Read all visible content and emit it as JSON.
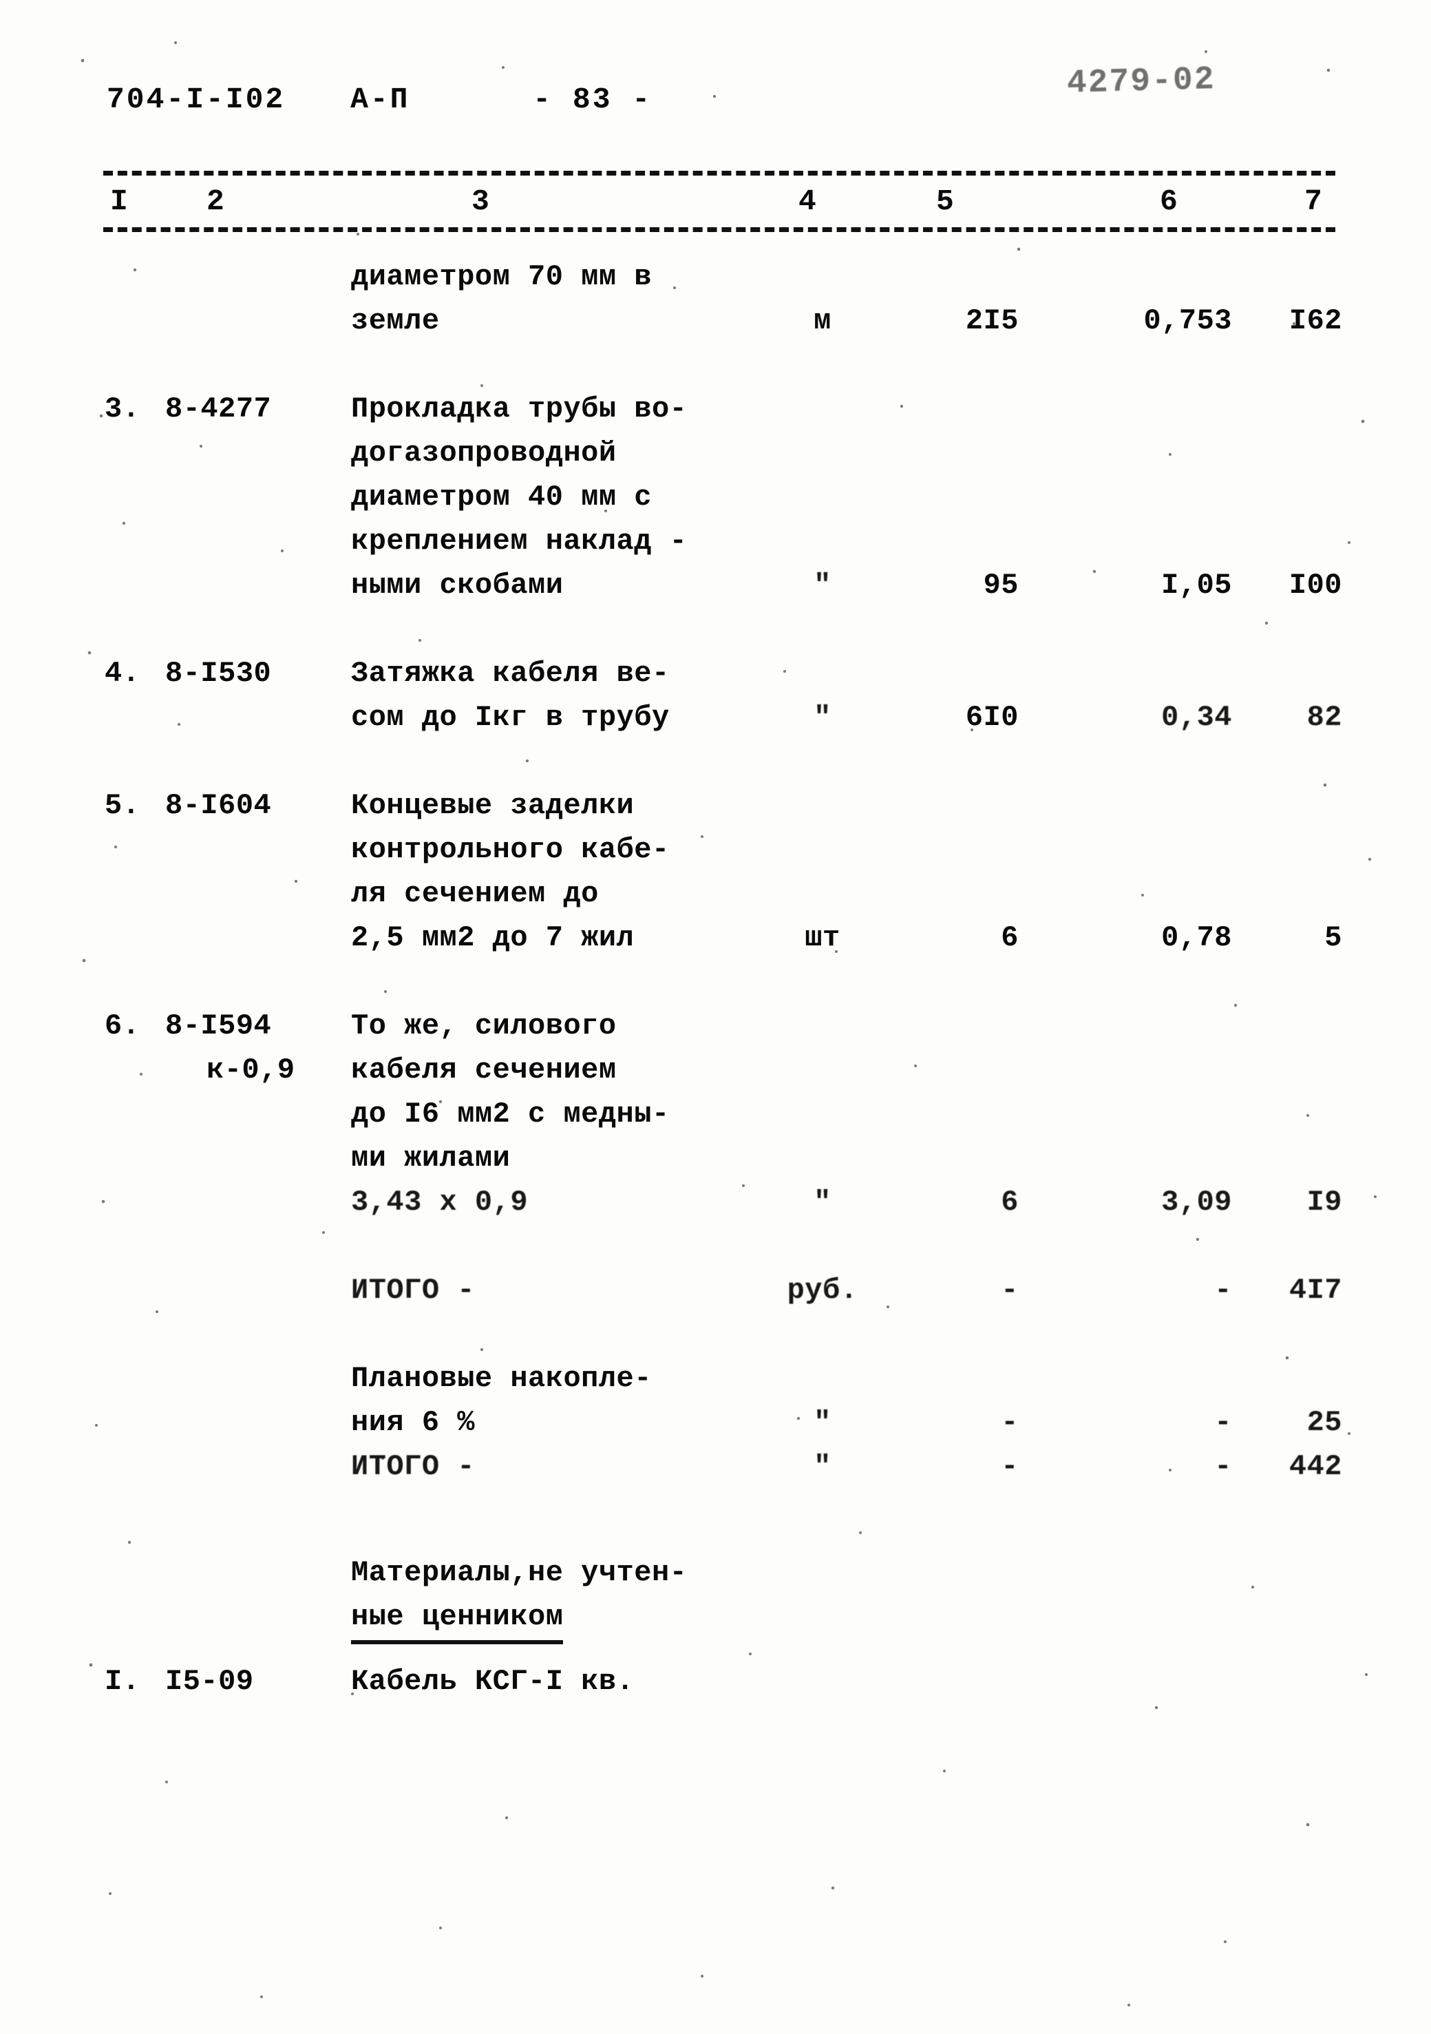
{
  "document": {
    "header": {
      "doc_code": "704-I-I02",
      "doc_part": "A-П",
      "page_number": "- 83 -",
      "stamp": "4279-02"
    },
    "column_numbers": [
      "I",
      "2",
      "3",
      "4",
      "5",
      "6",
      "7"
    ],
    "rows": [
      {
        "no": "",
        "code": "",
        "desc_lines": [
          "диаметром 70 мм в",
          "земле"
        ],
        "unit": "м",
        "qty": "2I5",
        "price": "0,753",
        "total": "I62"
      },
      {
        "no": "3.",
        "code": "8-4277",
        "desc_lines": [
          "Прокладка трубы во-",
          "догазопроводной",
          "диаметром 40 мм с",
          "креплением наклад -",
          "ными скобами"
        ],
        "unit": "\"",
        "qty": "95",
        "price": "I,05",
        "total": "I00"
      },
      {
        "no": "4.",
        "code": "8-I530",
        "desc_lines": [
          "Затяжка кабеля ве-",
          "сом до Iкг в трубу"
        ],
        "unit": "\"",
        "qty": "6I0",
        "price": "0,34",
        "total": "82"
      },
      {
        "no": "5.",
        "code": "8-I604",
        "desc_lines": [
          "Концевые заделки",
          "контрольного кабе-",
          "ля сечением до",
          "2,5 мм2 до 7 жил"
        ],
        "unit": "шт",
        "qty": "6",
        "price": "0,78",
        "total": "5"
      },
      {
        "no": "6.",
        "code": "8-I594",
        "code2": "к-0,9",
        "desc_lines": [
          "То же, силового",
          "кабеля сечением",
          "до I6 мм2 с медны-",
          "ми жилами",
          "3,43 x 0,9"
        ],
        "unit": "\"",
        "qty": "6",
        "price": "3,09",
        "total": "I9"
      }
    ],
    "totals": [
      {
        "label": "ИТОГО -",
        "unit": "руб.",
        "qty": "-",
        "price": "-",
        "total": "4I7"
      },
      {
        "label_lines": [
          "Плановые накопле-",
          "ния 6 %"
        ],
        "unit": "\"",
        "qty": "-",
        "price": "-",
        "total": "25"
      },
      {
        "label": "ИТОГО -",
        "unit": "\"",
        "qty": "-",
        "price": "-",
        "total": "442"
      }
    ],
    "section": {
      "title_line1": "Материалы,не учтен-",
      "title_line2": "ные ценником",
      "rows": [
        {
          "no": "I.",
          "code": "I5-09",
          "desc": "Кабель КСГ-I кв."
        }
      ]
    }
  }
}
